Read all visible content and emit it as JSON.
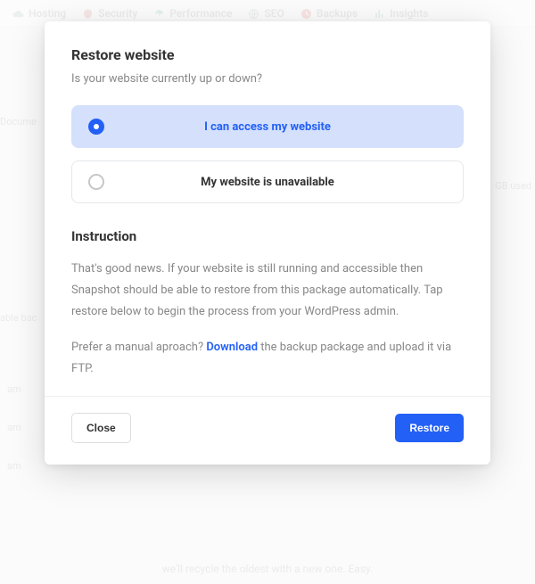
{
  "background": {
    "tabs": [
      "Hosting",
      "Security",
      "Performance",
      "SEO",
      "Backups",
      "Insights"
    ],
    "left_label_1": "Docume",
    "left_label_2": "able bac",
    "right_label": "GB used",
    "time": "am",
    "bottom_text": "we'll recycle the oldest with a new one. Easy."
  },
  "modal": {
    "title": "Restore website",
    "subtitle": "Is your website currently up or down?",
    "options": {
      "up": "I can access my website",
      "down": "My website is unavailable"
    },
    "instruction_heading": "Instruction",
    "instruction_p1": "That's good news. If your website is still running and accessible then Snapshot should be able to restore from this package automatically. Tap restore below to begin the process from your WordPress admin.",
    "instruction_p2_pre": "Prefer a manual aproach? ",
    "instruction_p2_link": "Download",
    "instruction_p2_post": " the backup package and upload it via FTP.",
    "close": "Close",
    "restore": "Restore"
  }
}
